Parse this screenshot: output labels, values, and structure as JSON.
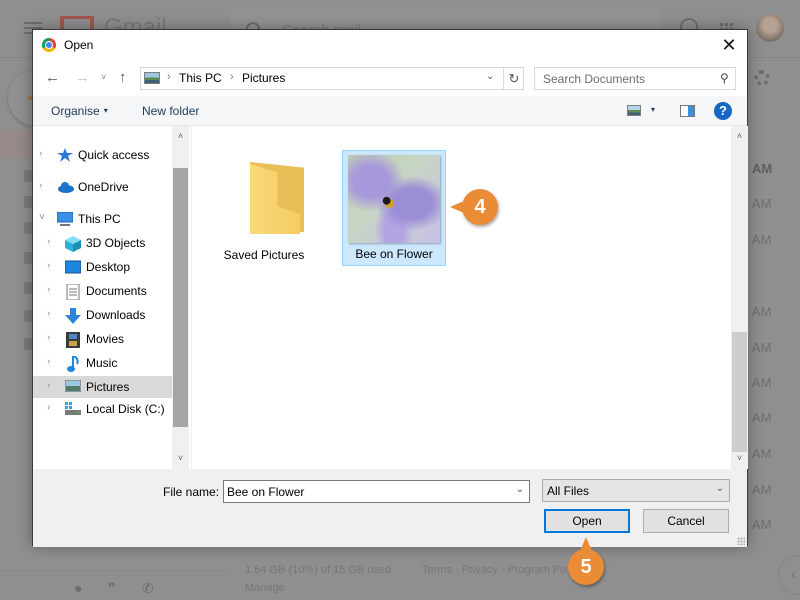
{
  "background": {
    "app_name": "Gmail",
    "search_placeholder": "Search mail",
    "email_times": [
      "AM",
      "AM",
      "AM",
      "AM",
      "AM",
      "AM",
      "AM",
      "AM",
      "AM",
      "AM"
    ],
    "storage": "1.64 GB (10%) of 15 GB used",
    "manage": "Manage",
    "footer_links": "Terms · Privacy · Program Po",
    "toggle_glyph": "‹"
  },
  "dialog": {
    "title": "Open",
    "close_glyph": "✕",
    "nav": {
      "back_glyph": "←",
      "forward_glyph": "→",
      "recent_glyph": "˅",
      "up_glyph": "↑"
    },
    "address": {
      "crumbs": [
        "This PC",
        "Pictures"
      ],
      "separator": "›",
      "dropdown_glyph": "⌄",
      "refresh_glyph": "↻"
    },
    "search": {
      "placeholder": "Search Documents",
      "icon_glyph": "⚲"
    },
    "toolbar": {
      "organise_label": "Organise",
      "new_folder_label": "New folder",
      "caret": "▾",
      "help_glyph": "?"
    },
    "nav_pane": {
      "items": [
        {
          "label": "Quick access",
          "expanded": false,
          "icon": "quick-access-star-icon"
        },
        {
          "label": "OneDrive",
          "expanded": false,
          "icon": "onedrive-cloud-icon"
        },
        {
          "label": "This PC",
          "expanded": true,
          "icon": "computer-monitor-icon"
        },
        {
          "label": "3D Objects",
          "expanded": false,
          "icon": "3d-objects-cube-icon"
        },
        {
          "label": "Desktop",
          "expanded": false,
          "icon": "desktop-icon"
        },
        {
          "label": "Documents",
          "expanded": false,
          "icon": "documents-icon"
        },
        {
          "label": "Downloads",
          "expanded": false,
          "icon": "downloads-arrow-icon"
        },
        {
          "label": "Movies",
          "expanded": false,
          "icon": "movies-film-icon"
        },
        {
          "label": "Music",
          "expanded": false,
          "icon": "music-note-icon"
        },
        {
          "label": "Pictures",
          "expanded": false,
          "icon": "pictures-icon",
          "selected": true
        },
        {
          "label": "Local Disk (C:)",
          "expanded": false,
          "icon": "local-disk-icon"
        }
      ],
      "chevron_collapsed": "›",
      "chevron_expanded": "˅",
      "scroll_up": "˄",
      "scroll_down": "˅"
    },
    "files": [
      {
        "name": "Saved Pictures",
        "type": "folder",
        "selected": false
      },
      {
        "name": "Bee on Flower",
        "type": "image",
        "selected": true
      }
    ],
    "file_name": {
      "label": "File name:",
      "value": "Bee on Flower",
      "chevron": "⌄"
    },
    "file_type": {
      "value": "All Files",
      "chevron": "⌄"
    },
    "buttons": {
      "open": "Open",
      "cancel": "Cancel"
    }
  },
  "callouts": {
    "step4": "4",
    "step5": "5",
    "color": "#e98c35"
  }
}
